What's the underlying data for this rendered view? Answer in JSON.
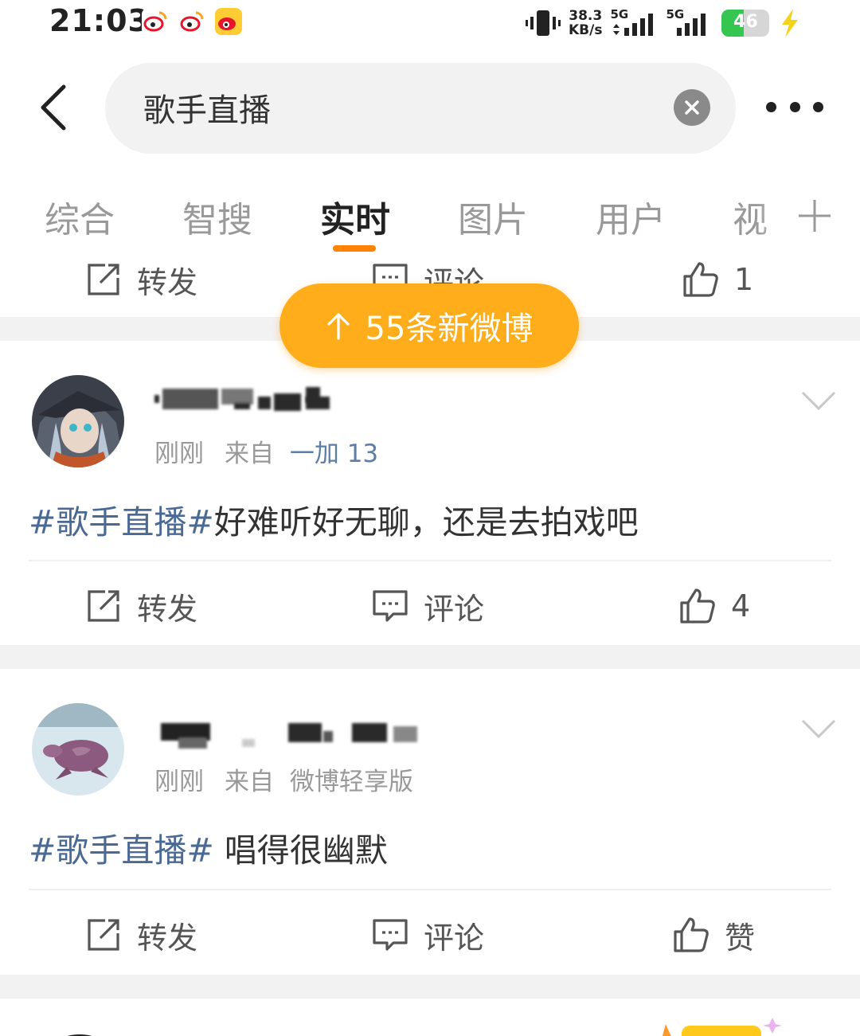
{
  "status_bar": {
    "time": "21:03",
    "net_speed_value": "38.3",
    "net_speed_unit": "KB/s",
    "sim1_type": "5G",
    "sim2_type": "5G",
    "battery_level": "46",
    "notification_icons": [
      "weibo-icon",
      "weibo-icon",
      "weibo-icon"
    ]
  },
  "header": {
    "search_query": "歌手直播",
    "back_icon": "chevron-left-icon",
    "clear_icon": "clear-icon",
    "more_icon": "more-dots-icon"
  },
  "tabs": [
    {
      "label": "综合",
      "active": false
    },
    {
      "label": "智搜",
      "active": false
    },
    {
      "label": "实时",
      "active": true
    },
    {
      "label": "图片",
      "active": false
    },
    {
      "label": "用户",
      "active": false
    },
    {
      "label": "视",
      "active": false
    }
  ],
  "tab_add_icon": "plus-icon",
  "new_posts_pill": "55条新微博",
  "partial_post": {
    "repost_label": "转发",
    "comment_label": "评论",
    "like_count": "1"
  },
  "posts": [
    {
      "time": "刚刚",
      "from_label": "来自",
      "source": "一加 13",
      "topic": "#歌手直播#",
      "text": "好难听好无聊，还是去拍戏吧",
      "repost_label": "转发",
      "comment_label": "评论",
      "like_label": "4"
    },
    {
      "time": "刚刚",
      "from_label": "来自",
      "source": "微博轻享版",
      "topic": "#歌手直播#",
      "text": " 唱得很幽默",
      "repost_label": "转发",
      "comment_label": "评论",
      "like_label": "赞"
    }
  ],
  "colors": {
    "accent_orange": "#ff8200",
    "pill_bg": "#ffad1a",
    "topic_link": "#4a6a94",
    "source_link": "#5c7ea6",
    "battery_green": "#35c651"
  }
}
